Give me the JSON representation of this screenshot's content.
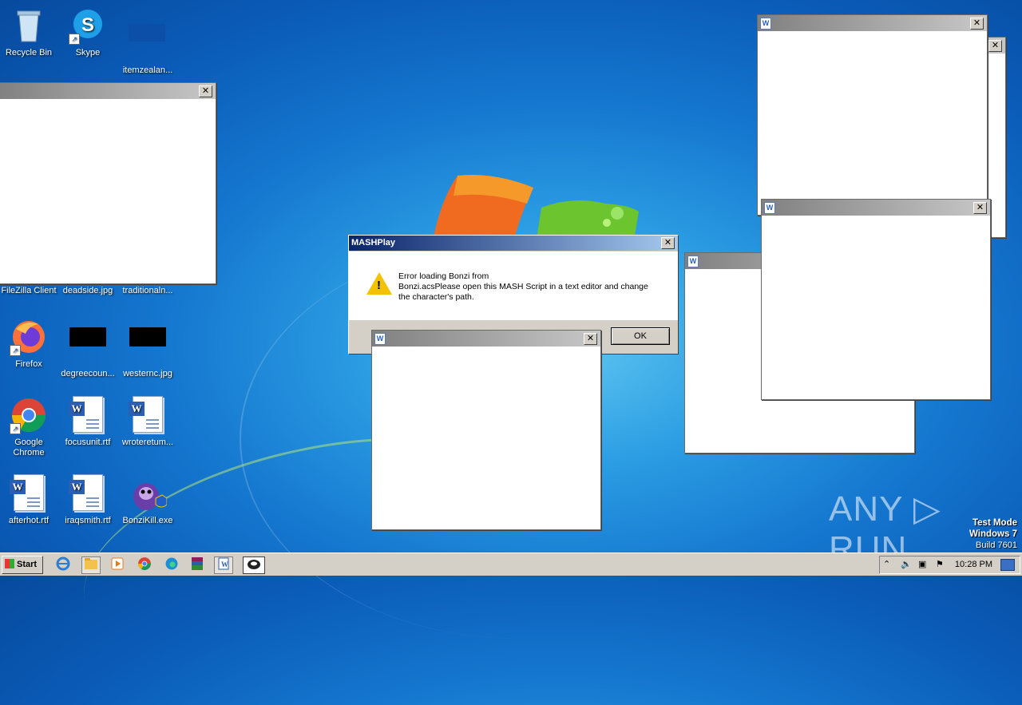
{
  "desktop": {
    "icons": [
      {
        "label": "Recycle Bin"
      },
      {
        "label": "Skype"
      },
      {
        "label": "itemzealan..."
      },
      {
        "label": "FileZilla Client"
      },
      {
        "label": "deadside.jpg"
      },
      {
        "label": "traditionaln..."
      },
      {
        "label": "Firefox"
      },
      {
        "label": "degreecoun..."
      },
      {
        "label": "westernc.jpg"
      },
      {
        "label": "Google Chrome"
      },
      {
        "label": "focusunit.rtf"
      },
      {
        "label": "wroteretum..."
      },
      {
        "label": "afterhot.rtf"
      },
      {
        "label": "iraqsmith.rtf"
      },
      {
        "label": "BonziKill.exe"
      }
    ]
  },
  "dialog": {
    "title": "MASHPlay",
    "message_line1": "Error loading Bonzi from",
    "message_line2": "Bonzi.acsPlease open this MASH Script in a text editor and change the character's path.",
    "ok_label": "OK",
    "close_glyph": "✕"
  },
  "window_close_glyph": "✕",
  "taskbar": {
    "start_label": "Start",
    "clock": "10:28 PM"
  },
  "watermark": {
    "text": "ANY ▷ RUN",
    "test_mode": "Test Mode",
    "os": "Windows 7",
    "build": "Build 7601"
  },
  "colors": {
    "dialog_title_start": "#0a246a",
    "dialog_title_end": "#a6caf0",
    "window_title_start": "#808080",
    "window_title_end": "#c8c8c8"
  }
}
